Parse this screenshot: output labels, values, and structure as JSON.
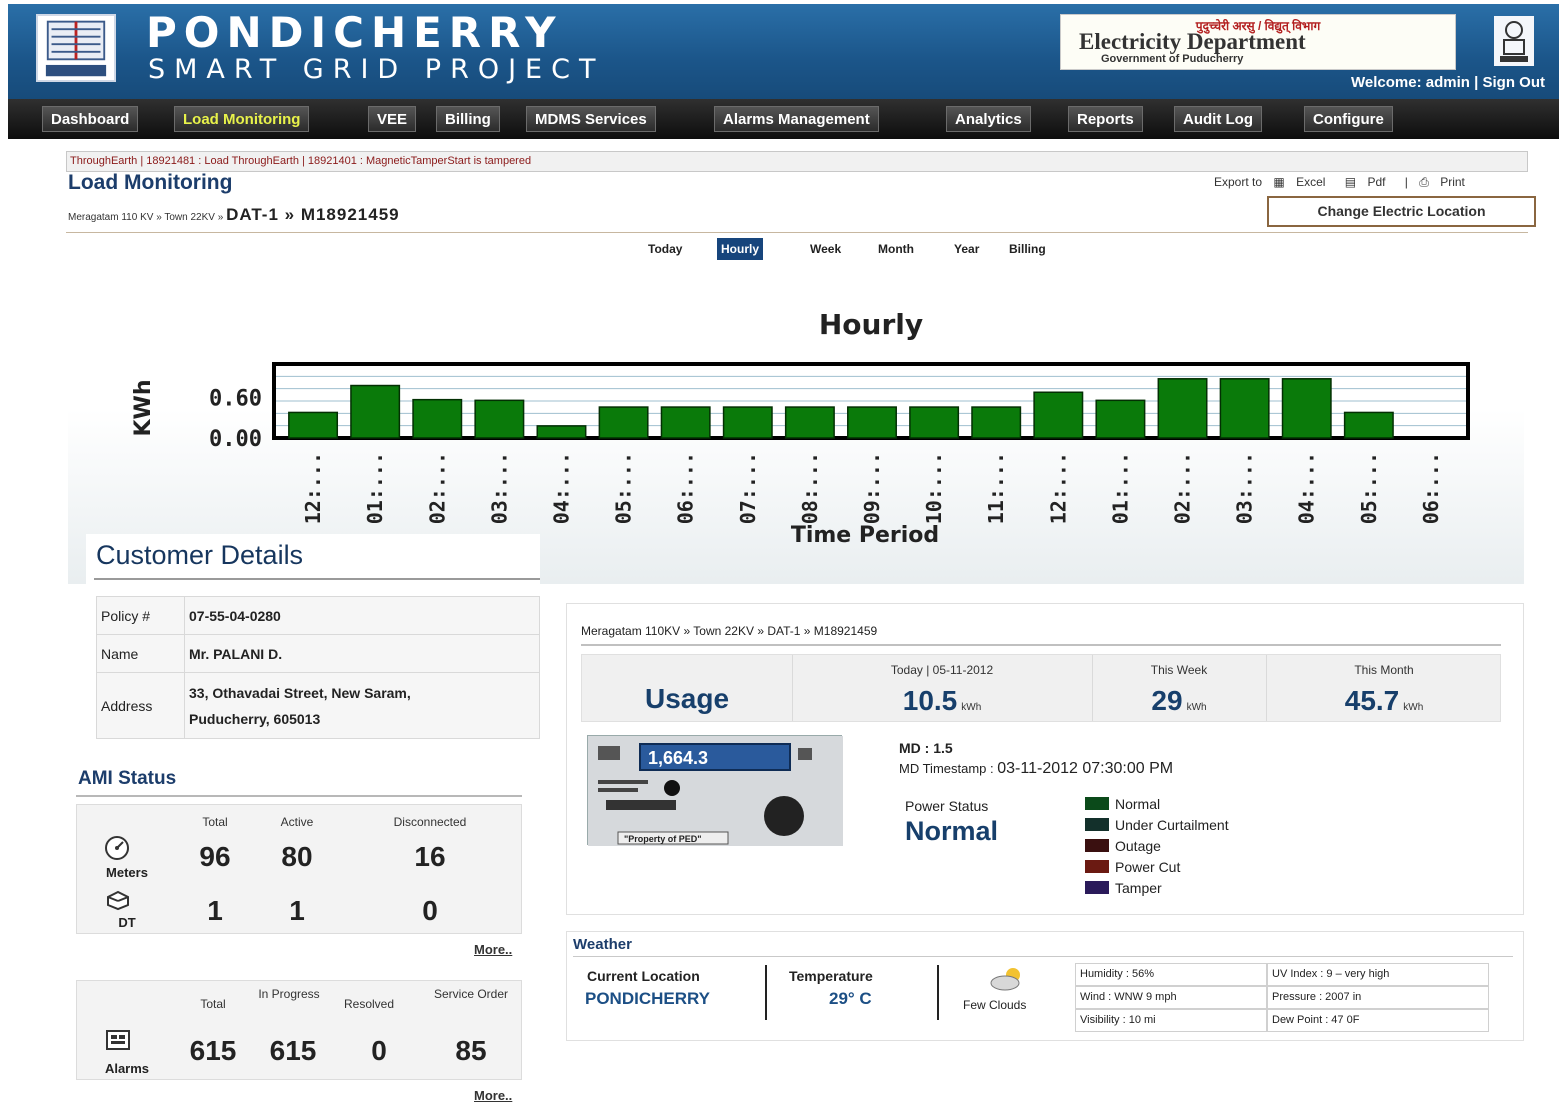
{
  "header": {
    "title": "PONDICHERRY",
    "subtitle": "SMART GRID PROJECT",
    "dept_hindi": "पुदुच्चेरी अरसु / विद्युत् विभाग",
    "dept_name": "Electricity Department",
    "dept_gov": "Government of Puducherry",
    "welcome": "Welcome: admin",
    "separator": "|",
    "sign_out": "Sign Out"
  },
  "nav": {
    "items": [
      {
        "label": "Dashboard"
      },
      {
        "label": "Load Monitoring"
      },
      {
        "label": "VEE"
      },
      {
        "label": "Billing"
      },
      {
        "label": "MDMS Services"
      },
      {
        "label": "Alarms Management"
      },
      {
        "label": "Analytics"
      },
      {
        "label": "Reports"
      },
      {
        "label": "Audit Log"
      },
      {
        "label": "Configure"
      }
    ],
    "active": "Load Monitoring"
  },
  "ticker": "ThroughEarth | 18921481 : Load ThroughEarth | 18921401 : MagneticTamperStart is tampered",
  "page": {
    "title": "Load Monitoring",
    "breadcrumb_small": "Meragatam 110 KV » Town 22KV »",
    "breadcrumb_big": "DAT-1 » M18921459",
    "export_label": "Export to",
    "excel": "Excel",
    "pdf": "Pdf",
    "pipe": "|",
    "print": "Print",
    "change_button": "Change Electric Location"
  },
  "tabs": [
    {
      "label": "Today"
    },
    {
      "label": "Hourly"
    },
    {
      "label": "Week"
    },
    {
      "label": "Month"
    },
    {
      "label": "Year"
    },
    {
      "label": "Billing"
    }
  ],
  "chart_data": {
    "type": "bar",
    "title": "Hourly",
    "xlabel": "Time Period",
    "ylabel": "KWh",
    "yticks": [
      "0.00",
      "0.60"
    ],
    "ylim": [
      0,
      1.1
    ],
    "grid": true,
    "bar_color": "#0a7a0a",
    "categories": [
      "12:...",
      "01:...",
      "02:...",
      "03:...",
      "04:...",
      "05:...",
      "06:...",
      "07:...",
      "08:...",
      "09:...",
      "10:...",
      "11:...",
      "12:...",
      "01:...",
      "02:...",
      "03:...",
      "04:...",
      "05:...",
      "06:..."
    ],
    "values": [
      0.38,
      0.78,
      0.57,
      0.56,
      0.18,
      0.46,
      0.46,
      0.46,
      0.46,
      0.46,
      0.46,
      0.46,
      0.68,
      0.56,
      0.88,
      0.88,
      0.88,
      0.38,
      0
    ]
  },
  "customer": {
    "title": "Customer Details",
    "policy_label": "Policy #",
    "policy_value": "07-55-04-0280",
    "name_label": "Name",
    "name_value": "Mr. PALANI D.",
    "address_label": "Address",
    "address_line1": "33, Othavadai Street, New Saram,",
    "address_line2": "Puducherry, 605013"
  },
  "ami": {
    "title": "AMI Status",
    "headers": [
      "Total",
      "Active",
      "Disconnected"
    ],
    "meters": {
      "label": "Meters",
      "total": "96",
      "active": "80",
      "disconnected": "16"
    },
    "dt": {
      "label": "DT",
      "total": "1",
      "active": "1",
      "disconnected": "0"
    },
    "more": "More..",
    "alarm_headers": [
      "Total",
      "In Progress",
      "Resolved",
      "Service Order"
    ],
    "alarms": {
      "label": "Alarms",
      "total": "615",
      "in_progress": "615",
      "resolved": "0",
      "service_order": "85"
    },
    "more2": "More.."
  },
  "meter_panel": {
    "breadcrumb": "Meragatam 110KV » Town 22KV » DAT-1 » M18921459",
    "usage_label": "Usage",
    "today_header": "Today | 05-11-2012",
    "week_header": "This Week",
    "month_header": "This Month",
    "today_value": "10.5",
    "week_value": "29",
    "month_value": "45.7",
    "unit": "kWh",
    "meter_reading": "1,664.3",
    "meter_property": "\"Property of PED\"",
    "md": "MD : 1.5",
    "md_ts_label": "MD Timestamp :",
    "md_ts_value": "03-11-2012 07:30:00 PM",
    "power_status_label": "Power Status",
    "power_status_value": "Normal",
    "legend": [
      {
        "label": "Normal",
        "color": "#0b4a1a"
      },
      {
        "label": "Under Curtailment",
        "color": "#13302b"
      },
      {
        "label": "Outage",
        "color": "#3a1010"
      },
      {
        "label": "Power Cut",
        "color": "#6b1a12"
      },
      {
        "label": "Tamper",
        "color": "#2a1a5a"
      }
    ]
  },
  "weather": {
    "title": "Weather",
    "location_label": "Current Location",
    "location_value": "PONDICHERRY",
    "temp_label": "Temperature",
    "temp_value": "29° C",
    "condition": "Few Clouds",
    "humidity": "Humidity : 56%",
    "wind": "Wind : WNW 9 mph",
    "visibility": "Visibility : 10 mi",
    "uv": "UV Index : 9 – very high",
    "pressure": "Pressure : 2007 in",
    "dew": "Dew Point : 47 0F"
  }
}
